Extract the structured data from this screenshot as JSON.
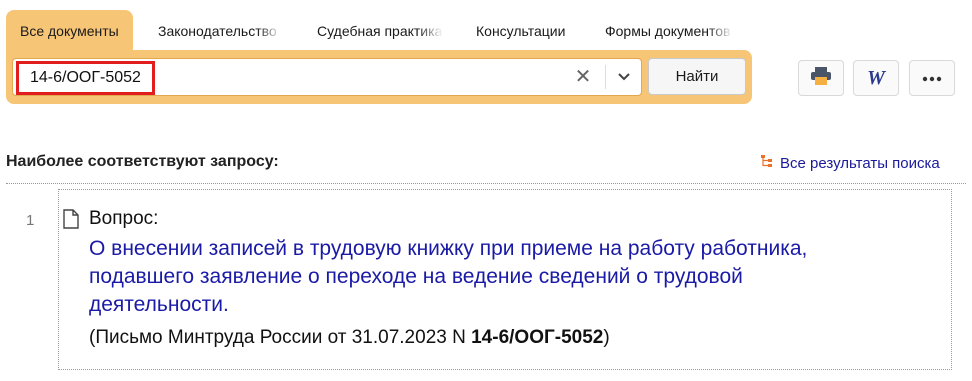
{
  "tabs": [
    {
      "label": "Все документы",
      "active": true
    },
    {
      "label": "Законодательство",
      "active": false
    },
    {
      "label": "Судебная практика",
      "active": false
    },
    {
      "label": "Консультации",
      "active": false
    },
    {
      "label": "Формы документов",
      "active": false
    }
  ],
  "search": {
    "value": "14-6/ООГ-5052",
    "clear_symbol": "✕",
    "find_label": "Найти"
  },
  "toolbar": {
    "print_icon": "printer-icon",
    "word_icon": "word-icon",
    "more_icon": "more-dots-icon",
    "word_glyph": "W"
  },
  "results_header": {
    "title": "Наиболее соответствуют запросу:",
    "all_results_label": "Все результаты поиска"
  },
  "results": [
    {
      "number": "1",
      "type_label": "Вопрос:",
      "title": "О внесении записей в трудовую книжку при приеме на работу работника, подавшего заявление о переходе на ведение сведений о трудовой деятельности.",
      "source_prefix": "(Письмо Минтруда России от 31.07.2023 N ",
      "source_doc_number": "14-6/ООГ-5052",
      "source_suffix": ")"
    }
  ],
  "colors": {
    "accent": "#f7c576",
    "highlight_border": "#e11d1d",
    "link": "#1a1aa6",
    "link_icon": "#e8722c"
  }
}
